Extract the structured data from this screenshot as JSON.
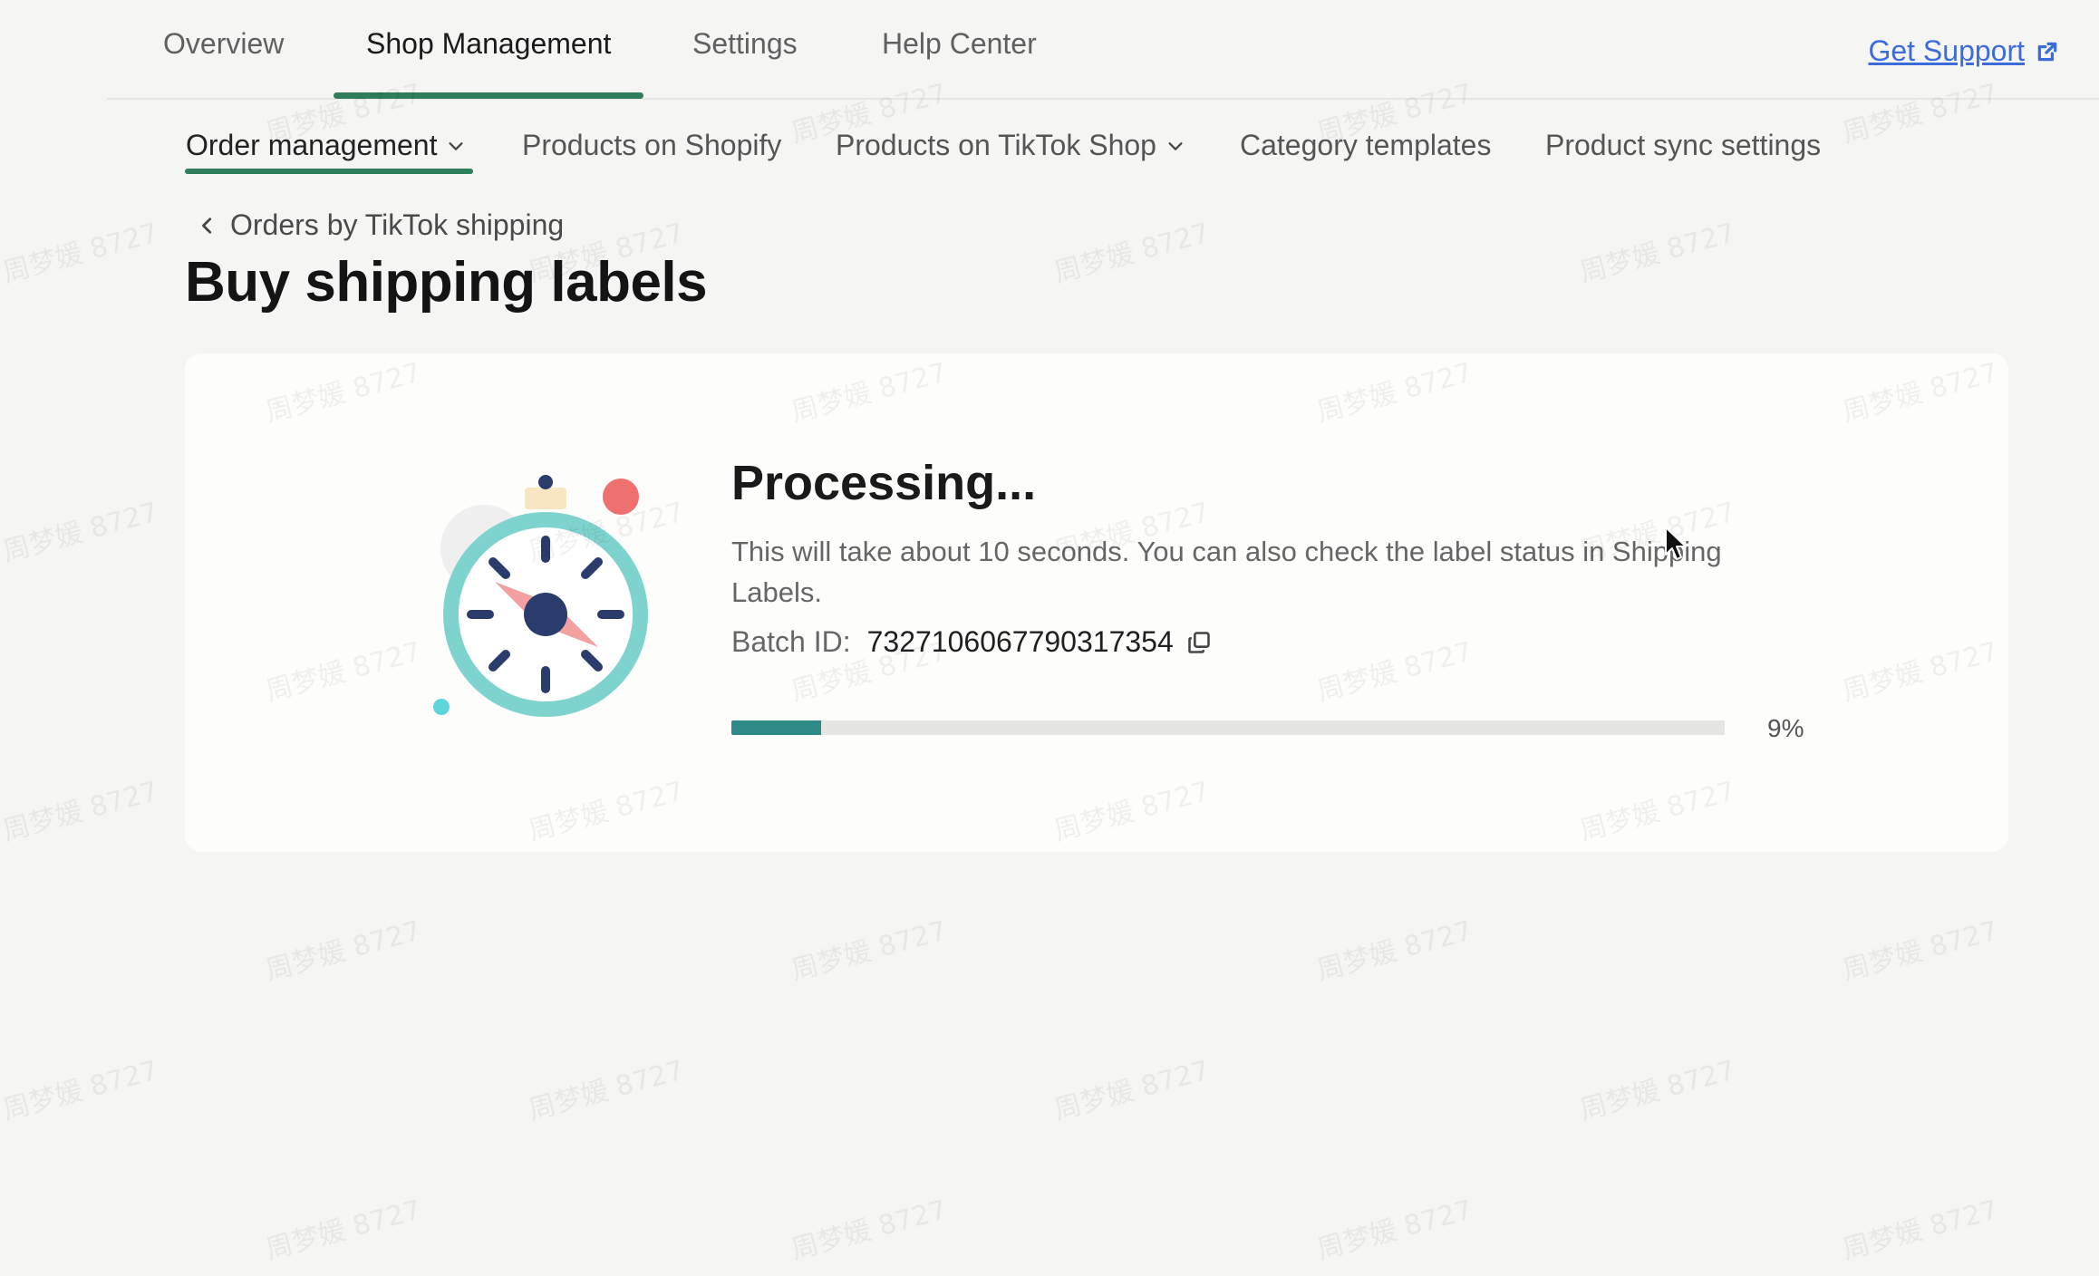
{
  "top_nav": {
    "tabs": [
      {
        "label": "Overview"
      },
      {
        "label": "Shop Management"
      },
      {
        "label": "Settings"
      },
      {
        "label": "Help Center"
      }
    ],
    "active_tab": "Shop Management",
    "support_label": "Get Support",
    "support_icon": "external-link-icon"
  },
  "sub_nav": {
    "items": [
      {
        "label": "Order management",
        "has_dropdown": true
      },
      {
        "label": "Products on Shopify",
        "has_dropdown": false
      },
      {
        "label": "Products on TikTok Shop",
        "has_dropdown": true
      },
      {
        "label": "Category templates",
        "has_dropdown": false
      },
      {
        "label": "Product sync settings",
        "has_dropdown": false
      }
    ],
    "active_item": "Order management"
  },
  "breadcrumb": {
    "label": "Orders by TikTok shipping"
  },
  "page": {
    "title": "Buy shipping labels"
  },
  "processing": {
    "title": "Processing...",
    "description": "This will take about 10 seconds. You can also check the label status in Shipping Labels.",
    "batch_label": "Batch ID:",
    "batch_id": "7327106067790317354",
    "progress_percent": 9,
    "progress_label": "9%"
  },
  "watermark": "周梦媛 8727",
  "colors": {
    "accent": "#2e7d5b",
    "progress": "#2d8a86",
    "link": "#3b6cd9",
    "background": "#f5f5f4"
  }
}
